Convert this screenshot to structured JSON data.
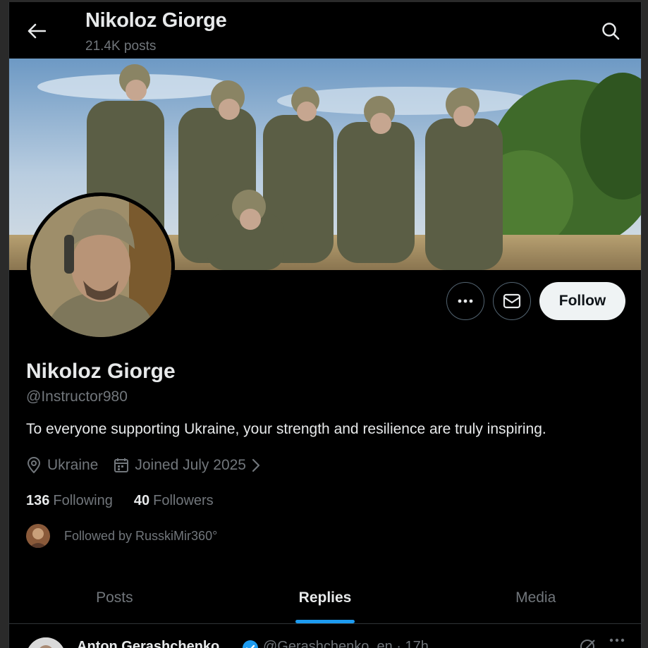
{
  "header": {
    "title": "Nikoloz Giorge",
    "posts_count": "21.4K posts",
    "back_icon": "arrow-left-icon",
    "search_icon": "search-icon"
  },
  "profile": {
    "display_name": "Nikoloz Giorge",
    "handle": "@Instructor980",
    "bio": "To everyone supporting Ukraine, your strength and resilience are truly inspiring.",
    "location": "Ukraine",
    "joined": "Joined July 2025",
    "following_count": "136",
    "following_label": "Following",
    "followers_count": "40",
    "followers_label": "Followers",
    "followed_by": "Followed by RusskiMir360°"
  },
  "actions": {
    "more_icon": "more-icon",
    "message_icon": "envelope-icon",
    "follow_label": "Follow"
  },
  "tabs": [
    {
      "label": "Posts",
      "active": false
    },
    {
      "label": "Replies",
      "active": true
    },
    {
      "label": "Media",
      "active": false
    }
  ],
  "post_preview": {
    "author": "Anton Gerashchenko",
    "meta": "@Gerashchenko_en · 17h"
  },
  "colors": {
    "background": "#000000",
    "text_primary": "#e7e9ea",
    "text_secondary": "#71767b",
    "accent": "#1d9bf0",
    "follow_button_bg": "#eff3f4"
  }
}
